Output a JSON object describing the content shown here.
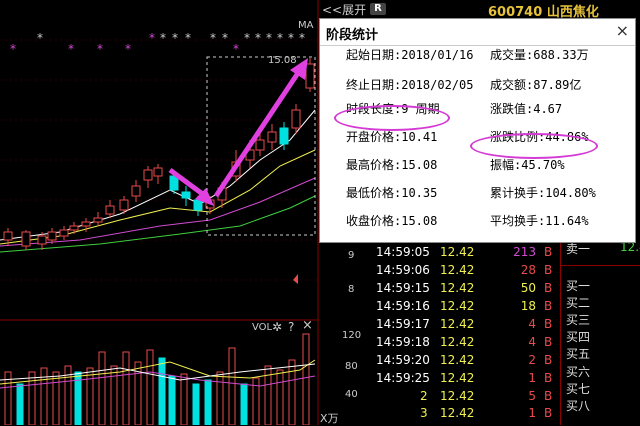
{
  "header": {
    "collapse_label": "<<展开",
    "r_badge": "R",
    "stock_code": "600740",
    "stock_name": "山西焦化"
  },
  "chart": {
    "ma_label": "MA",
    "range_high_label": "15.08",
    "axis_ticks": [
      "9",
      "8"
    ],
    "vol_label": "VOL",
    "vol_axis": [
      "120",
      "80",
      "40"
    ],
    "vol_unit": "X万",
    "colors": {
      "up": "#e84b4b",
      "down": "#00e0e0",
      "ma1": "#ffffff",
      "ma2": "#f0f050",
      "ma3": "#d14bd1",
      "ma4": "#3fcf3f",
      "arrow": "#e040e0"
    }
  },
  "dialog": {
    "title": "阶段统计",
    "close": "×",
    "left": [
      {
        "label": "起始日期:",
        "value": "2018/01/16"
      },
      {
        "label": "终止日期:",
        "value": "2018/02/05"
      },
      {
        "label": "时段长度:",
        "value": "9 周期"
      },
      {
        "label": "开盘价格:",
        "value": "10.41"
      },
      {
        "label": "最高价格:",
        "value": "15.08"
      },
      {
        "label": "最低价格:",
        "value": "10.35"
      },
      {
        "label": "收盘价格:",
        "value": "15.08"
      }
    ],
    "right": [
      {
        "label": "成交量:",
        "value": "688.33万"
      },
      {
        "label": "成交额:",
        "value": "87.89亿"
      },
      {
        "label": "涨跌值:",
        "value": "4.67"
      },
      {
        "label": "涨跌比例:",
        "value": "44.86%"
      },
      {
        "label": "振幅:",
        "value": "45.70%"
      },
      {
        "label": "累计换手:",
        "value": "104.80%"
      },
      {
        "label": "平均换手:",
        "value": "11.64%"
      }
    ]
  },
  "trades": [
    {
      "time": "14:59:04",
      "price": "12.42",
      "vol": "30",
      "side": "B",
      "vc": "r"
    },
    {
      "time": "14:59:05",
      "price": "12.42",
      "vol": "213",
      "side": "B",
      "vc": "p"
    },
    {
      "time": "14:59:06",
      "price": "12.42",
      "vol": "28",
      "side": "B",
      "vc": "r"
    },
    {
      "time": "14:59:15",
      "price": "12.42",
      "vol": "50",
      "side": "B",
      "vc": "y"
    },
    {
      "time": "14:59:16",
      "price": "12.42",
      "vol": "18",
      "side": "B",
      "vc": "y"
    },
    {
      "time": "14:59:17",
      "price": "12.42",
      "vol": "4",
      "side": "B",
      "vc": "r"
    },
    {
      "time": "14:59:18",
      "price": "12.42",
      "vol": "4",
      "side": "B",
      "vc": "r"
    },
    {
      "time": "14:59:20",
      "price": "12.42",
      "vol": "2",
      "side": "B",
      "vc": "r"
    },
    {
      "time": "14:59:25",
      "price": "12.42",
      "vol": "1",
      "side": "B",
      "vc": "r"
    },
    {
      "time": "",
      "price": "12.42",
      "vol": "5",
      "side": "B",
      "vc": "r"
    },
    {
      "time": "",
      "price": "12.42",
      "vol": "1",
      "side": "B",
      "vc": "r"
    }
  ],
  "trade_left_col": [
    "2",
    "3"
  ],
  "book": {
    "labels": [
      "卖一",
      "买一",
      "买二",
      "买三",
      "买四",
      "买五",
      "买六",
      "买七",
      "买八"
    ],
    "sell1_price": "12.4"
  }
}
